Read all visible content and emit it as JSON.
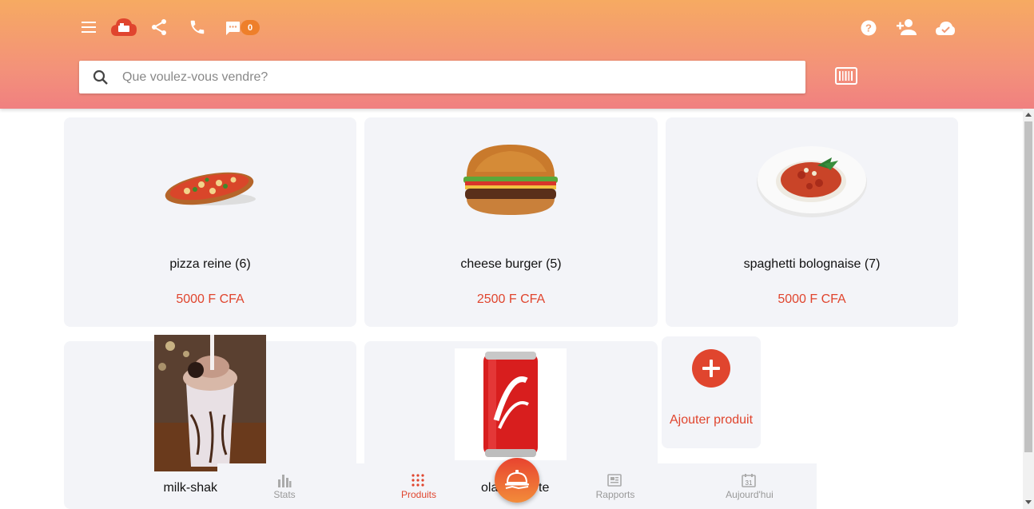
{
  "header": {
    "menu_icon": "menu-icon",
    "logo_icon": "cloud-shop-icon",
    "share_icon": "share-icon",
    "phone_icon": "phone-icon",
    "chat_icon": "chat-icon",
    "chat_count": "0",
    "help_icon": "help-icon",
    "add_user_icon": "add-user-icon",
    "sync_icon": "cloud-check-icon"
  },
  "search": {
    "placeholder": "Que voulez-vous vendre?",
    "barcode_icon": "barcode-icon"
  },
  "products": [
    {
      "name": "pizza reine (6)",
      "price": "5000 F CFA",
      "image": "pizza"
    },
    {
      "name": "cheese burger (5)",
      "price": "2500 F CFA",
      "image": "burger"
    },
    {
      "name": "spaghetti bolognaise (7)",
      "price": "5000 F CFA",
      "image": "spaghetti"
    },
    {
      "name": "milk-shak",
      "image": "milkshake"
    },
    {
      "name": "ola",
      "name_tail": "te",
      "image": "cola-can"
    }
  ],
  "add_product": {
    "label": "Ajouter produit"
  },
  "bottom_nav": [
    {
      "label": "Stats",
      "icon": "bar-chart-icon"
    },
    {
      "label": "Produits",
      "icon": "grid-dots-icon",
      "active": true
    },
    {
      "label": "Rapports",
      "icon": "newspaper-icon"
    },
    {
      "label": "Aujourd'hui",
      "icon": "calendar-icon",
      "calendar_day": "31"
    }
  ],
  "colors": {
    "accent": "#e0452e",
    "header_top": "#f6aa62",
    "header_bottom": "#f08080",
    "card_bg": "#f3f4f8"
  }
}
